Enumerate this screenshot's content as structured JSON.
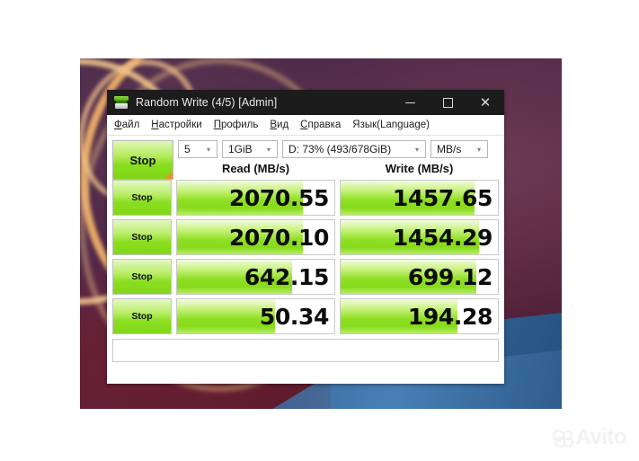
{
  "window": {
    "title": "Random Write (4/5) [Admin]",
    "icon": "disk-drive-icon",
    "controls": {
      "minimize": "minimize-icon",
      "maximize": "maximize-icon",
      "close": "close-icon"
    }
  },
  "menubar": {
    "items": [
      {
        "mnemonic": "Ф",
        "rest": "айл",
        "label": "Файл"
      },
      {
        "mnemonic": "Н",
        "rest": "астройки",
        "label": "Настройки"
      },
      {
        "mnemonic": "П",
        "rest": "рофиль",
        "label": "Профиль"
      },
      {
        "mnemonic": "В",
        "rest": "ид",
        "label": "Вид"
      },
      {
        "mnemonic": "С",
        "rest": "правка",
        "label": "Справка"
      },
      {
        "mnemonic": "",
        "rest": "Язык(Language)",
        "label": "Язык(Language)"
      }
    ]
  },
  "toolbar": {
    "stop_label": "Stop",
    "count_value": "5",
    "size_value": "1GiB",
    "drive_value": "D: 73% (493/678GiB)",
    "unit_value": "MB/s"
  },
  "columns": {
    "read_header": "Read (MB/s)",
    "write_header": "Write (MB/s)"
  },
  "rows": [
    {
      "stop_label": "Stop",
      "read_value": "2070.55",
      "read_fill_pct": 80,
      "write_value": "1457.65",
      "write_fill_pct": 85
    },
    {
      "stop_label": "Stop",
      "read_value": "2070.10",
      "read_fill_pct": 80,
      "write_value": "1454.29",
      "write_fill_pct": 88
    },
    {
      "stop_label": "Stop",
      "read_value": "642.15",
      "read_fill_pct": 73,
      "write_value": "699.12",
      "write_fill_pct": 86
    },
    {
      "stop_label": "Stop",
      "read_value": "50.34",
      "read_fill_pct": 62,
      "write_value": "194.28",
      "write_fill_pct": 74
    }
  ],
  "statusbar": {
    "text": ""
  },
  "watermark": {
    "text": "Avito",
    "icon": "avito-logo-icon"
  },
  "colors": {
    "accent_green": "#8ade1f",
    "titlebar": "#1c1c1c",
    "stop_corner_orange": "#e8952a"
  }
}
